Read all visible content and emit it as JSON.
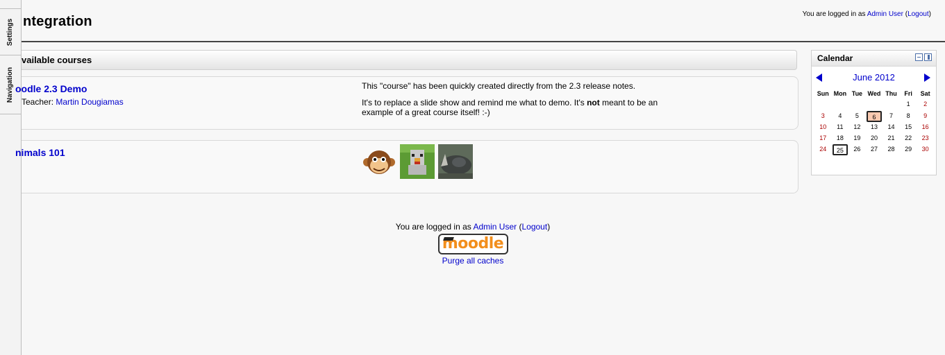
{
  "dock": {
    "settings_label": "Settings",
    "navigation_label": "Navigation"
  },
  "header": {
    "title": "ntegration",
    "login_prefix": "You are logged in as ",
    "user": "Admin User",
    "logout_open": " (",
    "logout": "Logout",
    "logout_close": ")"
  },
  "courses": {
    "heading": "vailable courses",
    "items": [
      {
        "name": "oodle 2.3 Demo",
        "teacher_label": "Teacher: ",
        "teacher": "Martin Dougiamas",
        "summary_1": "This \"course\" has been quickly created directly from the 2.3 release notes.",
        "summary_2_a": "It's to replace a slide show and remind me what to demo.   It's ",
        "summary_2_bold": "not",
        "summary_2_b": " meant to be an example of a great course itself!  :-)"
      },
      {
        "name": "nimals 101",
        "images": [
          "monkey",
          "chicken",
          "rhino"
        ]
      }
    ]
  },
  "footer": {
    "login_prefix": "You are logged in as ",
    "user": "Admin User",
    "logout_open": " (",
    "logout": "Logout",
    "logout_close": ")",
    "logo": "moodle",
    "purge": "Purge all caches"
  },
  "calendar": {
    "title": "Calendar",
    "month": "June 2012",
    "weekdays": [
      "Sun",
      "Mon",
      "Tue",
      "Wed",
      "Thu",
      "Fri",
      "Sat"
    ],
    "weeks": [
      [
        "",
        "",
        "",
        "",
        "",
        "1",
        "2"
      ],
      [
        "3",
        "4",
        "5",
        "6",
        "7",
        "8",
        "9"
      ],
      [
        "10",
        "11",
        "12",
        "13",
        "14",
        "15",
        "16"
      ],
      [
        "17",
        "18",
        "19",
        "20",
        "21",
        "22",
        "23"
      ],
      [
        "24",
        "25",
        "26",
        "27",
        "28",
        "29",
        "30"
      ]
    ],
    "event_day": "6",
    "today": "25",
    "colors": {
      "weekend": "#aa0000",
      "event_bg": "#f9c9b0",
      "link": "#0000cc"
    }
  }
}
